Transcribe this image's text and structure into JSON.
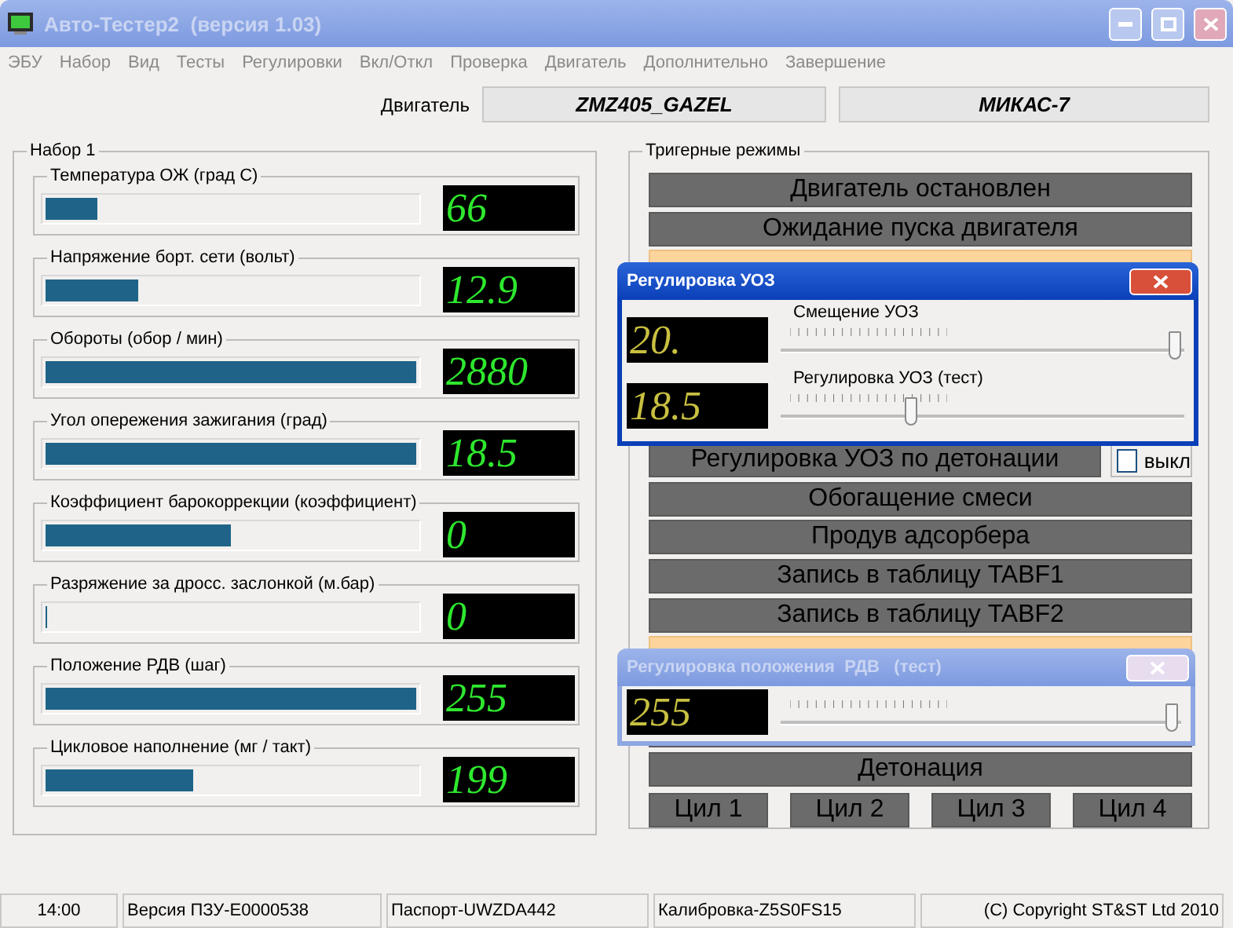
{
  "window": {
    "title": "Авто-Тестер2  (версия 1.03)",
    "active": false
  },
  "menu": [
    "ЭБУ",
    "Набор",
    "Вид",
    "Тесты",
    "Регулировки",
    "Вкл/Откл",
    "Проверка",
    "Двигатель",
    "Дополнительно",
    "Завершение"
  ],
  "engine": {
    "label": "Двигатель",
    "model": "ZMZ405_GAZEL",
    "controller": "МИКАС-7"
  },
  "gauge_group": {
    "title": "Набор 1",
    "gauges": [
      {
        "label": "Температура  ОЖ (град С)",
        "value": "66",
        "level": 0.14
      },
      {
        "label": "Напряжение борт. сети  (вольт)",
        "value": "12.9",
        "level": 0.25
      },
      {
        "label": "Обороты  (обор / мин)",
        "value": "2880",
        "level": 1
      },
      {
        "label": "Угол опережения зажигания  (град)",
        "value": "18.5",
        "level": 1
      },
      {
        "label": "Коэффициент барокоррекции  (коэффициент)",
        "value": "0",
        "level": 0.5
      },
      {
        "label": "Разряжение за дросс. заслонкой  (м.бар)",
        "value": "0",
        "level": 0
      },
      {
        "label": "Положение РДВ  (шаг)",
        "value": "255",
        "level": 1
      },
      {
        "label": "Цикловое наполнение  (мг / такт)",
        "value": "199",
        "level": 0.4
      }
    ]
  },
  "modes_group": {
    "title": "Тригерные режимы",
    "modes": [
      {
        "kind": "row",
        "label": "Двигатель остановлен",
        "active": false
      },
      {
        "kind": "row",
        "label": "Ожидание пуска двигателя",
        "active": false
      },
      {
        "kind": "row",
        "active": true
      },
      {
        "kind": "row"
      },
      {
        "kind": "row"
      },
      {
        "kind": "row"
      },
      {
        "kind": "row"
      },
      {
        "kind": "check",
        "label": "Регулировка УОЗ по детонации",
        "active": false,
        "check_label": "выкл",
        "checked": false
      },
      {
        "kind": "row",
        "label": "Обогащение смеси",
        "active": false
      },
      {
        "kind": "row",
        "label": "Продув адсорбера",
        "active": false
      },
      {
        "kind": "row",
        "label": "Запись в таблицу TABF1",
        "active": false
      },
      {
        "kind": "row",
        "label": "Запись в таблицу TABF2",
        "active": false
      },
      {
        "kind": "row",
        "active": true
      },
      {
        "kind": "row"
      },
      {
        "kind": "row"
      },
      {
        "kind": "row",
        "label": "Детонация",
        "active": false
      },
      {
        "kind": "cylinders",
        "items": [
          "Цил 1",
          "Цил 2",
          "Цил 3",
          "Цил 4"
        ]
      }
    ]
  },
  "uoz_dialog": {
    "title": "Регулировка УОЗ",
    "active": true,
    "sliders": [
      {
        "label": "Смещение УОЗ",
        "value": "20.",
        "level": 1
      },
      {
        "label": "Регулировка УОЗ  (тест)",
        "value": "18.5",
        "level": 0.33
      }
    ]
  },
  "rdv_dialog": {
    "title": "Регулировка положения  РДВ   (тест)",
    "active": false,
    "sliders": [
      {
        "value": "255",
        "level": 1
      }
    ]
  },
  "status_bar": [
    "14:00",
    "Версия ПЗУ-E0000538",
    "Паспорт-UWZDA442",
    "Калибровка-Z5S0FS15",
    "(C) Copyright ST&ST Ltd 2010"
  ]
}
